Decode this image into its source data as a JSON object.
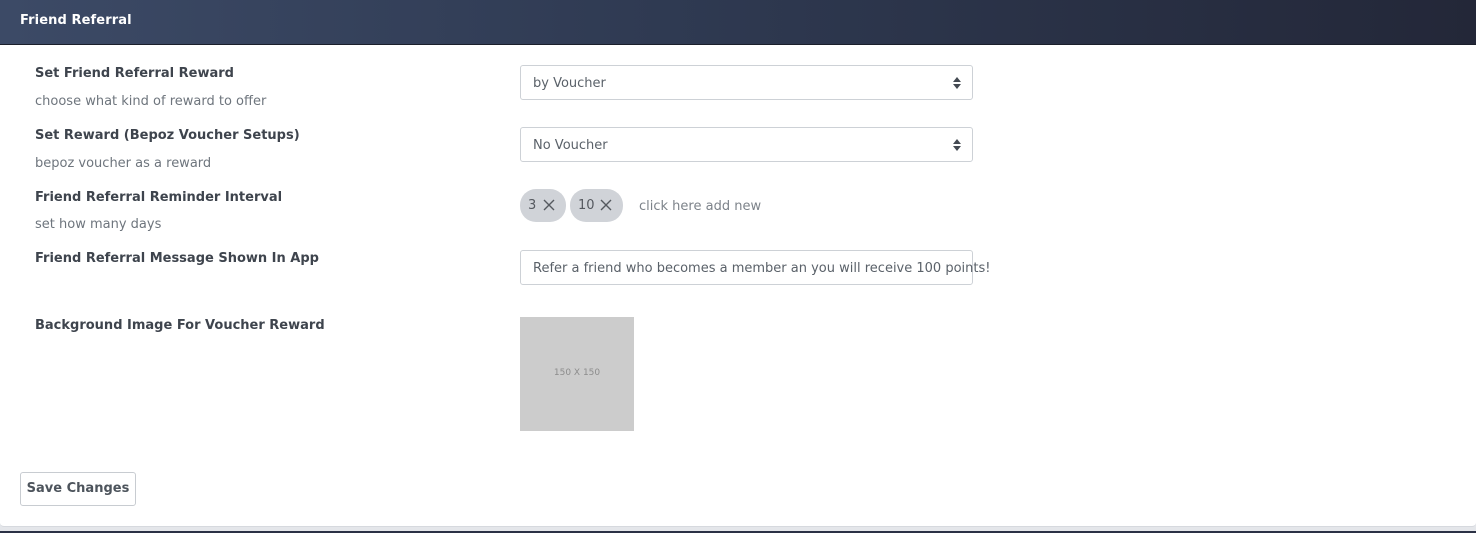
{
  "header": {
    "title": "Friend Referral"
  },
  "fields": {
    "reward_type": {
      "label": "Set Friend Referral Reward",
      "help": "choose what kind of reward to offer",
      "value": "by Voucher"
    },
    "voucher_setup": {
      "label": "Set Reward (Bepoz Voucher Setups)",
      "help": "bepoz voucher as a reward",
      "value": "No Voucher"
    },
    "reminder_interval": {
      "label": "Friend Referral Reminder Interval",
      "help": "set how many days",
      "tags": [
        "3",
        "10"
      ],
      "add_new": "click here add new"
    },
    "app_message": {
      "label": "Friend Referral Message Shown In App",
      "value": "Refer a friend who becomes a member an you will receive 100 points!"
    },
    "background_image": {
      "label": "Background Image For Voucher Reward",
      "placeholder_text": "150 X 150"
    }
  },
  "actions": {
    "save_label": "Save Changes"
  },
  "icons": {
    "select_arrows": "sort-arrows-icon",
    "tag_remove": "close-icon"
  },
  "colors": {
    "header_start": "#3c4a66",
    "header_end": "#232738",
    "tag_background": "#d0d3d8",
    "placeholder_background": "#cccccc"
  }
}
